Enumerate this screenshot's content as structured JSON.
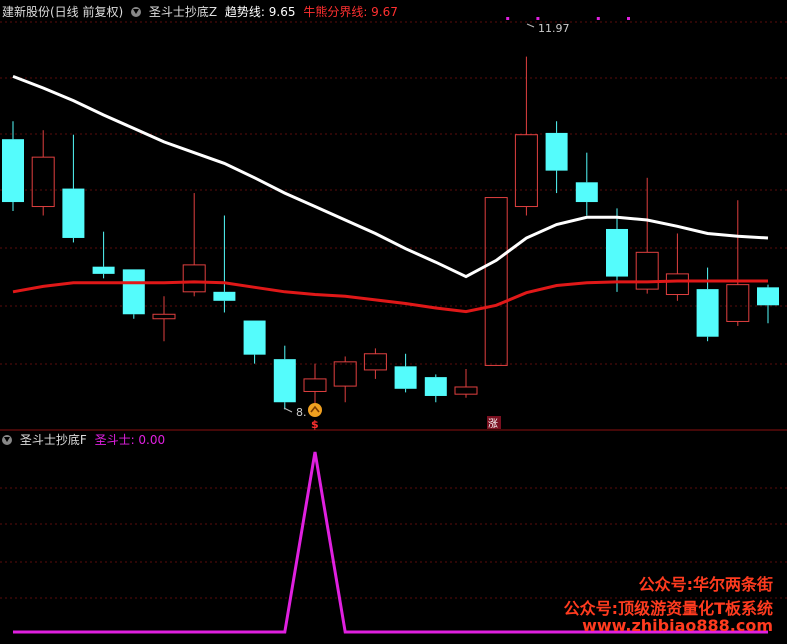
{
  "header": {
    "stock": "建新股份(日线 前复权)",
    "indicator": "圣斗士抄底Z",
    "trend_label": "趋势线: 9.65",
    "divider_label": "牛熊分界线: 9.67",
    "colors": {
      "trend": "#ffffff",
      "divider": "#e01818"
    }
  },
  "sub_header": {
    "indicator": "圣斗士抄底F",
    "value_label": "圣斗士: 0.00",
    "color": "#e020e0"
  },
  "watermark": {
    "line1": "公众号:华尔两条街",
    "line2": "公众号:顶级游资量化T板系统",
    "line3": "www.zhibiao888.com"
  },
  "markers": {
    "buy_signal": "$",
    "rise_signal": "涨",
    "high_label": "11.97",
    "low_label": "8."
  },
  "chart_data": [
    {
      "type": "candlestick",
      "title": "圣斗士抄底Z",
      "colors": {
        "up": "#e04040",
        "down": "#54fcfc"
      },
      "ylim": [
        7.9,
        12.4
      ],
      "candles": [
        {
          "o": 11.05,
          "c": 10.35,
          "h": 11.25,
          "l": 10.25
        },
        {
          "o": 10.3,
          "c": 10.85,
          "h": 11.15,
          "l": 10.2
        },
        {
          "o": 10.5,
          "c": 9.95,
          "h": 11.1,
          "l": 9.9
        },
        {
          "o": 9.63,
          "c": 9.55,
          "h": 10.02,
          "l": 9.5
        },
        {
          "o": 9.6,
          "c": 9.1,
          "h": 9.6,
          "l": 9.05
        },
        {
          "o": 9.05,
          "c": 9.1,
          "h": 9.3,
          "l": 8.8
        },
        {
          "o": 9.35,
          "c": 9.65,
          "h": 10.45,
          "l": 9.3
        },
        {
          "o": 9.35,
          "c": 9.25,
          "h": 10.2,
          "l": 9.12
        },
        {
          "o": 9.03,
          "c": 8.65,
          "h": 9.03,
          "l": 8.55
        },
        {
          "o": 8.6,
          "c": 8.12,
          "h": 8.75,
          "l": 8.04
        },
        {
          "o": 8.24,
          "c": 8.38,
          "h": 8.55,
          "l": 8.0
        },
        {
          "o": 8.3,
          "c": 8.57,
          "h": 8.63,
          "l": 8.12
        },
        {
          "o": 8.48,
          "c": 8.66,
          "h": 8.72,
          "l": 8.38
        },
        {
          "o": 8.52,
          "c": 8.27,
          "h": 8.66,
          "l": 8.23
        },
        {
          "o": 8.4,
          "c": 8.19,
          "h": 8.43,
          "l": 8.12
        },
        {
          "o": 8.21,
          "c": 8.29,
          "h": 8.49,
          "l": 8.17
        },
        {
          "o": 8.53,
          "c": 10.4,
          "h": 10.4,
          "l": 8.53
        },
        {
          "o": 10.3,
          "c": 11.1,
          "h": 11.97,
          "l": 10.2
        },
        {
          "o": 11.12,
          "c": 10.7,
          "h": 11.25,
          "l": 10.45
        },
        {
          "o": 10.57,
          "c": 10.35,
          "h": 10.9,
          "l": 10.2
        },
        {
          "o": 10.05,
          "c": 9.52,
          "h": 10.28,
          "l": 9.35
        },
        {
          "o": 9.38,
          "c": 9.79,
          "h": 10.62,
          "l": 9.33
        },
        {
          "o": 9.32,
          "c": 9.55,
          "h": 10.0,
          "l": 9.25
        },
        {
          "o": 9.38,
          "c": 8.85,
          "h": 9.62,
          "l": 8.8
        },
        {
          "o": 9.02,
          "c": 9.43,
          "h": 10.37,
          "l": 8.97
        },
        {
          "o": 9.4,
          "c": 9.2,
          "h": 9.43,
          "l": 9.0
        }
      ],
      "series": [
        {
          "name": "趋势线",
          "color": "#ffffff",
          "values": [
            11.75,
            11.62,
            11.48,
            11.32,
            11.17,
            11.02,
            10.9,
            10.78,
            10.62,
            10.45,
            10.3,
            10.15,
            10.0,
            9.83,
            9.68,
            9.52,
            9.7,
            9.95,
            10.1,
            10.18,
            10.18,
            10.15,
            10.08,
            10.0,
            9.97,
            9.95
          ]
        },
        {
          "name": "牛熊分界线",
          "color": "#e01818",
          "values": [
            9.35,
            9.41,
            9.45,
            9.45,
            9.45,
            9.45,
            9.46,
            9.45,
            9.4,
            9.35,
            9.32,
            9.3,
            9.26,
            9.22,
            9.17,
            9.13,
            9.2,
            9.34,
            9.42,
            9.45,
            9.46,
            9.46,
            9.47,
            9.47,
            9.47,
            9.47
          ]
        }
      ]
    },
    {
      "type": "line",
      "title": "圣斗士抄底F",
      "ylim": [
        0,
        1
      ],
      "series": [
        {
          "name": "圣斗士",
          "color": "#e020e0",
          "values": [
            0,
            0,
            0,
            0,
            0,
            0,
            0,
            0,
            0,
            0,
            1,
            0,
            0,
            0,
            0,
            0,
            0,
            0,
            0,
            0,
            0,
            0,
            0,
            0,
            0,
            0
          ]
        }
      ]
    }
  ]
}
